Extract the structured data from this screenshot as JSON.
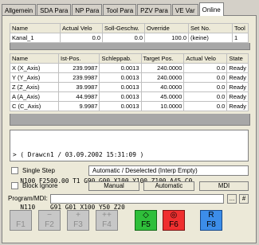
{
  "tabs": [
    {
      "label": "Allgemein",
      "active": false
    },
    {
      "label": "SDA Para",
      "active": false
    },
    {
      "label": "NP Para",
      "active": false
    },
    {
      "label": "Tool Para",
      "active": false
    },
    {
      "label": "PZV Para",
      "active": false
    },
    {
      "label": "VE Var",
      "active": false
    },
    {
      "label": "Online",
      "active": true
    }
  ],
  "channel_table": {
    "headers": [
      "Name",
      "Actual Velo",
      "Soll-Geschw.",
      "Override",
      "Set No.",
      "Tool"
    ],
    "rows": [
      [
        "Kanal_1",
        "0.0",
        "0.0",
        "100.0",
        "(keine)",
        "1"
      ]
    ]
  },
  "axes_table": {
    "headers": [
      "Name",
      "Ist-Pos.",
      "Schleppab.",
      "Target Pos.",
      "Actual Velo",
      "State"
    ],
    "rows": [
      [
        "X (X_Axis)",
        "239.9987",
        "0.0013",
        "240.0000",
        "0.0",
        "Ready"
      ],
      [
        "Y (Y_Axis)",
        "239.9987",
        "0.0013",
        "240.0000",
        "0.0",
        "Ready"
      ],
      [
        "Z (Z_Axis)",
        "39.9987",
        "0.0013",
        "40.0000",
        "0.0",
        "Ready"
      ],
      [
        "A (A_Axis)",
        "44.9987",
        "0.0013",
        "45.0000",
        "0.0",
        "Ready"
      ],
      [
        "C (C_Axis)",
        "9.9987",
        "0.0013",
        "10.0000",
        "0.0",
        "Ready"
      ]
    ]
  },
  "program": {
    "lines": [
      "> ( Drawcn1 / 03.09.2002 15:31:09 )",
      "  N100 F2500.00 T1 G90 G00 X100 Y100 Z100 A45 C0",
      "  N110    G91 G01 X100 Y50 Z20"
    ]
  },
  "options": {
    "single_step": "Single Step",
    "block_ignore": "Block Ignore",
    "status_text": "Automatic / Deselected (Interp Empty)"
  },
  "mode_buttons": {
    "manual": "Manual",
    "automatic": "Automatic",
    "mdi": "MDI"
  },
  "mdi": {
    "label": "Program/MDI:",
    "value": "",
    "browse_label": "...",
    "clear_label": "#"
  },
  "function_keys": [
    {
      "symbol": "",
      "label": "F1",
      "enabled": false
    },
    {
      "symbol": "−",
      "label": "F2",
      "enabled": false
    },
    {
      "symbol": "+",
      "label": "F3",
      "enabled": false
    },
    {
      "symbol": "++",
      "label": "F4",
      "enabled": false
    },
    {
      "symbol": "◇",
      "label": "F5",
      "enabled": true,
      "color": "#2fbf3a"
    },
    {
      "symbol": "◎",
      "label": "F6",
      "enabled": true,
      "color": "#ef2f2f"
    },
    {
      "symbol": "R",
      "label": "F8",
      "enabled": true,
      "color": "#3c8de9"
    }
  ]
}
